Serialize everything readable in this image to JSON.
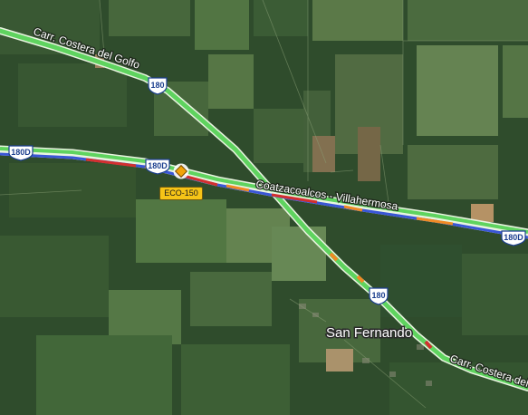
{
  "map": {
    "road_labels": {
      "costera_nw": "Carr. Costera del Golfo",
      "costera_se": "Carr. Costera del",
      "coatzacoalcos": "Coatzacoalcos - Villahermosa"
    },
    "shields": {
      "s180_north": "180",
      "s180_south": "180",
      "s180d_west": "180D",
      "s180d_mid": "180D",
      "s180d_east": "180D"
    },
    "places": {
      "san_fernando": "San Fernando"
    },
    "incident": {
      "label": "ECO-150",
      "icon": "warning-diamond-icon",
      "color": "#f2a30a"
    },
    "traffic_colors": {
      "free": "#5fd35f",
      "slow": "#f08a24",
      "jam": "#d32f2f",
      "route": "#3a56d6"
    }
  }
}
